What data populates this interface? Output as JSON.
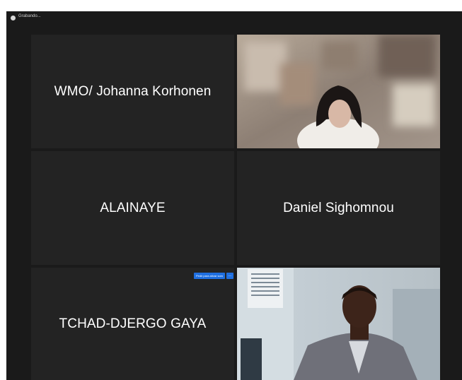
{
  "window": {
    "status_text": "Grabando..."
  },
  "participants": [
    {
      "name": "WMO/ Johanna Korhonen",
      "has_video": false
    },
    {
      "name": "",
      "has_video": true,
      "video_description_icon": "person-video"
    },
    {
      "name": "ALAINAYE",
      "has_video": false
    },
    {
      "name": "Daniel Sighomnou",
      "has_video": false
    },
    {
      "name": "TCHAD-DJERGO GAYA",
      "has_video": false,
      "badge": {
        "label": "Pedir para ativar som",
        "more_icon": "ellipsis-icon"
      }
    },
    {
      "name": "",
      "has_video": true,
      "video_description_icon": "person-video"
    }
  ],
  "colors": {
    "background": "#1a1a1a",
    "tile": "#232323",
    "badge": "#1f6fe0",
    "text": "#ffffff"
  }
}
